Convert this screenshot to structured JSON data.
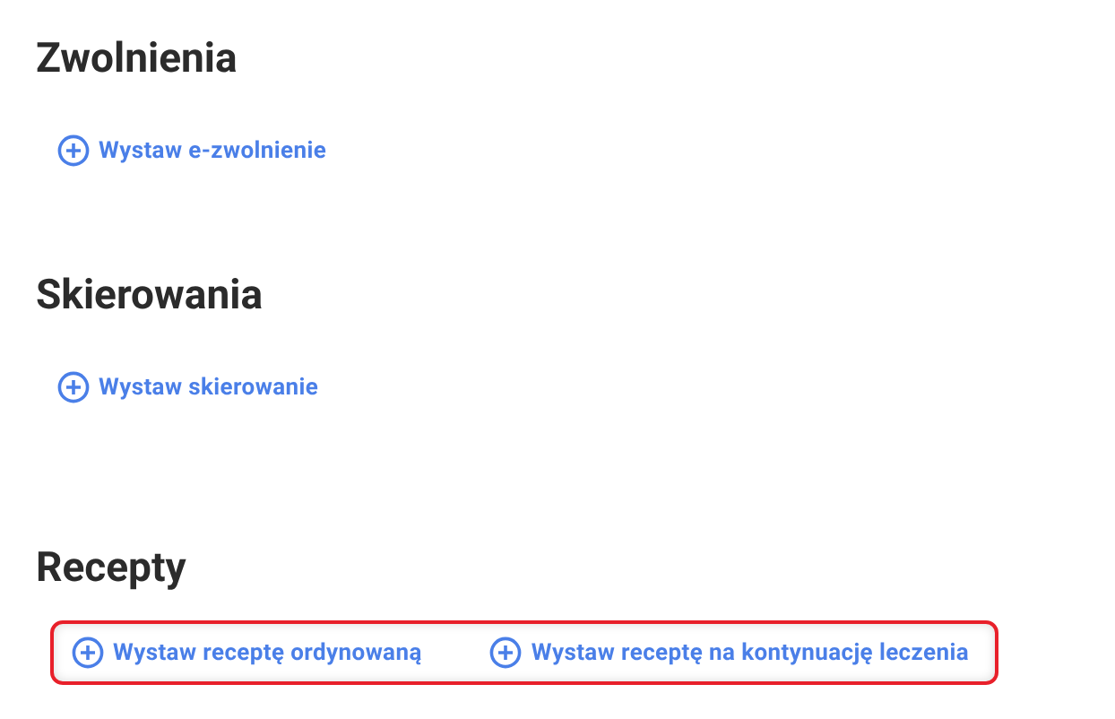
{
  "sections": [
    {
      "title": "Zwolnienia",
      "highlighted": false,
      "actions": [
        "Wystaw e-zwolnienie"
      ]
    },
    {
      "title": "Skierowania",
      "highlighted": false,
      "actions": [
        "Wystaw skierowanie"
      ]
    },
    {
      "title": "Recepty",
      "highlighted": true,
      "actions": [
        "Wystaw receptę ordynowaną",
        "Wystaw receptę na kontynuację leczenia"
      ]
    }
  ]
}
